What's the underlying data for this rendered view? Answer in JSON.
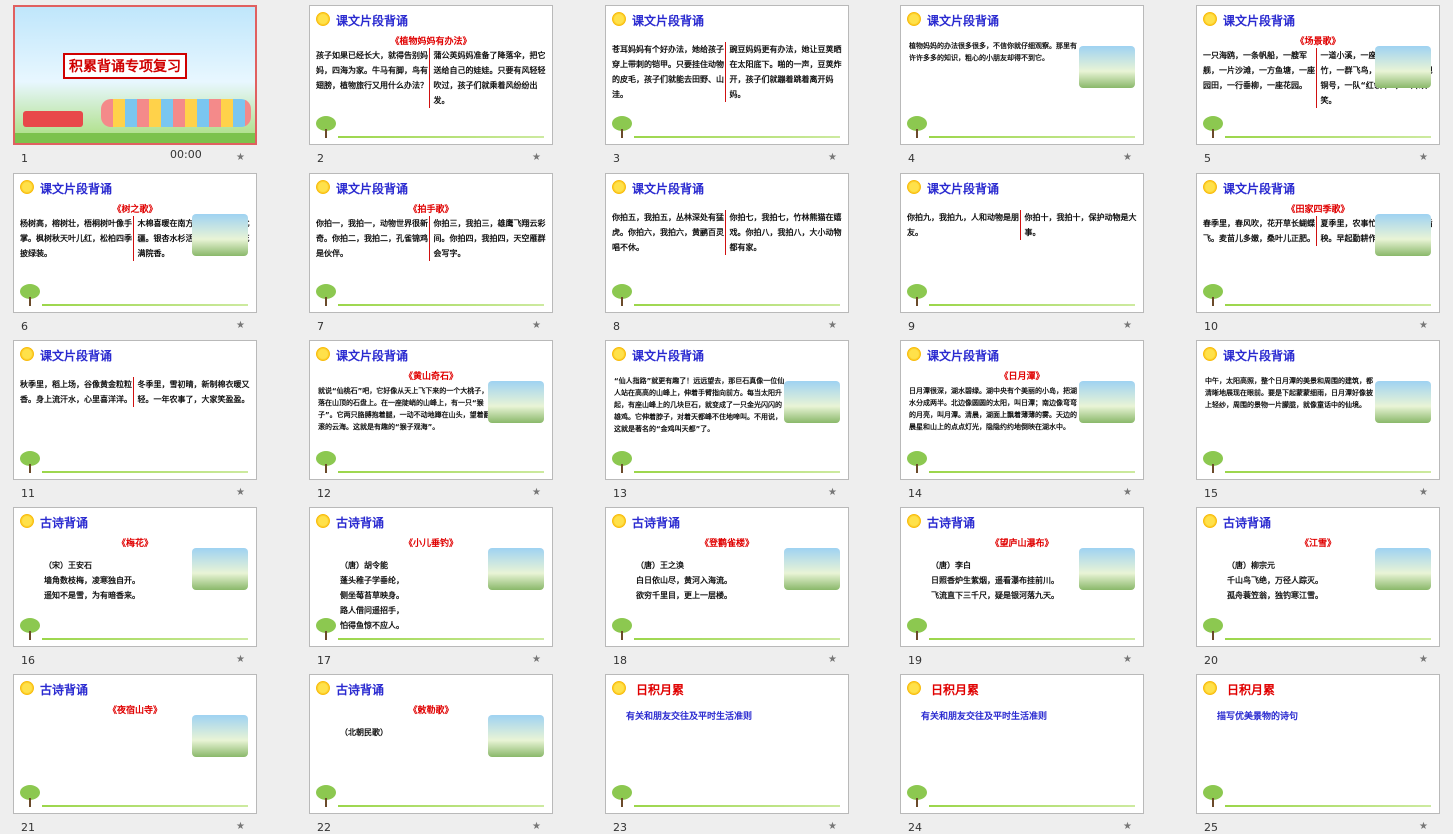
{
  "status": {
    "time": "00:00"
  },
  "slides": [
    {
      "num": "1",
      "title": "积累背诵专项复习",
      "type": "cover"
    },
    {
      "num": "2",
      "title": "课文片段背诵",
      "subtitle": "《植物妈妈有办法》",
      "cols": [
        "孩子如果已经长大，就得告别妈妈，四海为家。牛马有脚，鸟有翅膀，植物旅行又用什么办法？",
        "蒲公英妈妈准备了降落伞，把它送给自己的娃娃。只要有风轻轻吹过，孩子们就乘着风纷纷出发。"
      ]
    },
    {
      "num": "3",
      "title": "课文片段背诵",
      "cols": [
        "苍耳妈妈有个好办法，她给孩子穿上带刺的铠甲。只要挂住动物的皮毛，孩子们就能去田野、山洼。",
        "豌豆妈妈更有办法，她让豆荚晒在太阳底下。啪的一声，豆荚炸开，孩子们就蹦着跳着离开妈妈。"
      ]
    },
    {
      "num": "4",
      "title": "课文片段背诵",
      "body": "植物妈妈的办法很多很多，不信你就仔细观察。那里有许许多多的知识，粗心的小朋友却得不到它。"
    },
    {
      "num": "5",
      "title": "课文片段背诵",
      "subtitle": "《场景歌》",
      "cols": [
        "一只海鸥，一条帆船，一艘军舰，一片沙滩，一方鱼塘，一座园田，一行垂柳，一座花园。",
        "一道小溪，一座石桥，一丛翠竹，一群飞鸟，一面队旗，一把铜号，一队“红领巾”，一片欢笑。"
      ]
    },
    {
      "num": "6",
      "title": "课文片段背诵",
      "subtitle": "《树之歌》",
      "cols": [
        "杨树高，榕树壮，梧桐树叶像手掌。枫树秋天叶儿红，松柏四季披绿装。",
        "木棉喜暖在南方，桦树耐寒守北疆。银杏水杉活化石，金桂开花满院香。"
      ]
    },
    {
      "num": "7",
      "title": "课文片段背诵",
      "subtitle": "《拍手歌》",
      "cols": [
        "你拍一，我拍一，动物世界很新奇。你拍二，我拍二，孔雀锦鸡是伙伴。",
        "你拍三，我拍三，雄鹰飞翔云彩间。你拍四，我拍四，天空雁群会写字。"
      ]
    },
    {
      "num": "8",
      "title": "课文片段背诵",
      "cols": [
        "你拍五，我拍五，丛林深处有猛虎。你拍六，我拍六，黄鹂百灵唱不休。",
        "你拍七，我拍七，竹林熊猫在嬉戏。你拍八，我拍八，大小动物都有家。"
      ]
    },
    {
      "num": "9",
      "title": "课文片段背诵",
      "cols": [
        "你拍九，我拍九，人和动物是朋友。",
        "你拍十，我拍十，保护动物是大事。"
      ]
    },
    {
      "num": "10",
      "title": "课文片段背诵",
      "subtitle": "《田家四季歌》",
      "cols": [
        "春季里，春风吹，花开草长蝴蝶飞。麦苗儿多嫩，桑叶儿正肥。",
        "夏季里，农事忙，采了蚕桑又插秧。早起勤耕作，归来戴月光。"
      ]
    },
    {
      "num": "11",
      "title": "课文片段背诵",
      "cols": [
        "秋季里，稻上场，谷像黄金粒粒香。身上流汗水，心里喜洋洋。",
        "冬季里，雪初晴，新制棉衣暖又轻。一年农事了，大家笑盈盈。"
      ]
    },
    {
      "num": "12",
      "title": "课文片段背诵",
      "subtitle": "《黄山奇石》",
      "body": "就说“仙桃石”吧，它好像从天上飞下来的一个大桃子，落在山顶的石盘上。在一座陡峭的山峰上，有一只“猴子”。它两只胳膊抱着腿，一动不动地蹲在山头，望着翻滚的云海。这就是有趣的“猴子观海”。"
    },
    {
      "num": "13",
      "title": "课文片段背诵",
      "body": "“仙人指路”就更有趣了！远远望去，那巨石真像一位仙人站在高高的山峰上，伸着手臂指向前方。每当太阳升起，有座山峰上的几块巨石，就变成了一只金光闪闪的雄鸡。它伸着脖子，对着天都峰不住地啼叫。不用说，这就是著名的“金鸡叫天都”了。"
    },
    {
      "num": "14",
      "title": "课文片段背诵",
      "subtitle": "《日月潭》",
      "body": "日月潭很深，湖水碧绿。湖中央有个美丽的小岛，把湖水分成两半。北边像圆圆的太阳，叫日潭；南边像弯弯的月亮，叫月潭。清晨，湖面上飘着薄薄的雾。天边的晨星和山上的点点灯光，隐隐约约地倒映在湖水中。"
    },
    {
      "num": "15",
      "title": "课文片段背诵",
      "body": "中午，太阳高照，整个日月潭的美景和周围的建筑，都清晰地展现在眼前。要是下起蒙蒙细雨，日月潭好像披上轻纱，周围的景物一片朦胧，就像童话中的仙境。"
    },
    {
      "num": "16",
      "title": "古诗背诵",
      "subtitle": "《梅花》",
      "lines": [
        "（宋）王安石",
        "墙角数枝梅，凌寒独自开。",
        "遥知不是雪，为有暗香来。"
      ]
    },
    {
      "num": "17",
      "title": "古诗背诵",
      "subtitle": "《小儿垂钓》",
      "lines": [
        "（唐）胡令能",
        "蓬头稚子学垂纶，",
        "侧坐莓苔草映身。",
        "路人借问遥招手，",
        "怕得鱼惊不应人。"
      ]
    },
    {
      "num": "18",
      "title": "古诗背诵",
      "subtitle": "《登鹳雀楼》",
      "lines": [
        "（唐）王之涣",
        "白日依山尽，黄河入海流。",
        "欲穷千里目，更上一层楼。"
      ]
    },
    {
      "num": "19",
      "title": "古诗背诵",
      "subtitle": "《望庐山瀑布》",
      "lines": [
        "（唐）李白",
        "日照香炉生紫烟，遥看瀑布挂前川。",
        "飞流直下三千尺，疑是银河落九天。"
      ]
    },
    {
      "num": "20",
      "title": "古诗背诵",
      "subtitle": "《江雪》",
      "lines": [
        "（唐）柳宗元",
        "千山鸟飞绝，万径人踪灭。",
        "孤舟蓑笠翁，独钓寒江雪。"
      ]
    },
    {
      "num": "21",
      "title": "古诗背诵",
      "subtitle": "《夜宿山寺》"
    },
    {
      "num": "22",
      "title": "古诗背诵",
      "subtitle": "《敕勒歌》",
      "lines": [
        "（北朝民歌）"
      ]
    },
    {
      "num": "23",
      "title": "日积月累",
      "subtitle": "有关和朋友交往及平时生活准则"
    },
    {
      "num": "24",
      "title": "日积月累",
      "subtitle": "有关和朋友交往及平时生活准则"
    },
    {
      "num": "25",
      "title": "日积月累",
      "subtitle": "描写优美景物的诗句"
    }
  ]
}
